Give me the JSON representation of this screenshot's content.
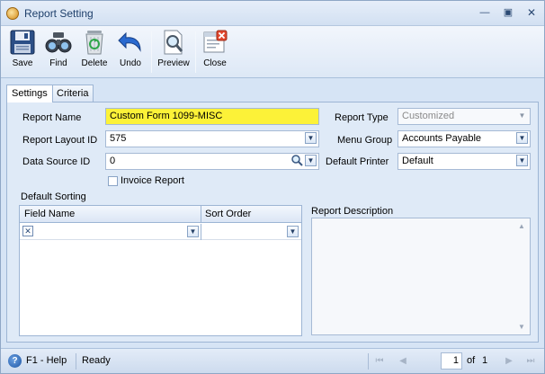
{
  "window": {
    "title": "Report Setting"
  },
  "toolbar": {
    "save": "Save",
    "find": "Find",
    "delete": "Delete",
    "undo": "Undo",
    "preview": "Preview",
    "close": "Close"
  },
  "tabs": [
    {
      "label": "Settings",
      "active": true
    },
    {
      "label": "Criteria",
      "active": false
    }
  ],
  "form": {
    "report_name_label": "Report Name",
    "report_name_value": "Custom Form 1099-MISC",
    "report_layout_id_label": "Report Layout ID",
    "report_layout_id_value": "575",
    "data_source_id_label": "Data Source ID",
    "data_source_id_value": "0",
    "invoice_report_label": "Invoice Report",
    "invoice_report_checked": false,
    "report_type_label": "Report Type",
    "report_type_value": "Customized",
    "menu_group_label": "Menu Group",
    "menu_group_value": "Accounts Payable",
    "default_printer_label": "Default Printer",
    "default_printer_value": "Default"
  },
  "sorting": {
    "title": "Default Sorting",
    "columns": [
      "Field Name",
      "Sort Order"
    ],
    "rows": [
      {
        "field_name": "",
        "sort_order": ""
      }
    ]
  },
  "description": {
    "label": "Report Description",
    "value": ""
  },
  "status": {
    "help": "F1 - Help",
    "state": "Ready",
    "page_current": "1",
    "page_of": "of",
    "page_total": "1"
  },
  "colors": {
    "highlight": "#fcf238",
    "window_bg": "#d6e4f5",
    "accent": "#1e3f6b"
  }
}
